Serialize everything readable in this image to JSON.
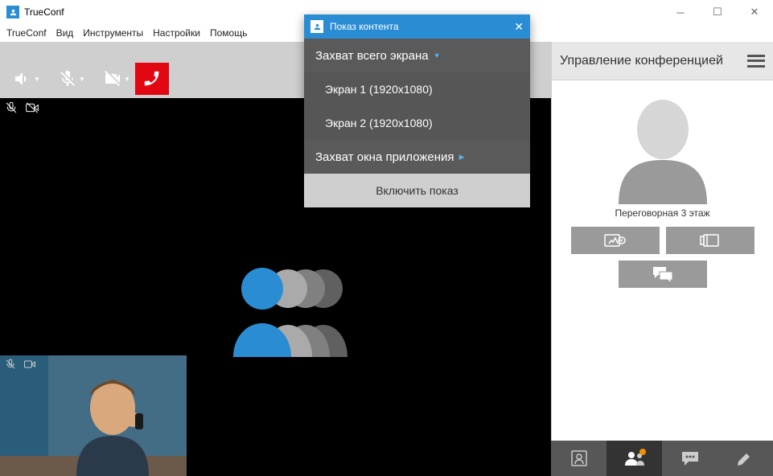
{
  "window": {
    "title": "TrueConf"
  },
  "menu": {
    "trueconf": "TrueConf",
    "view": "Вид",
    "tools": "Инструменты",
    "settings": "Настройки",
    "help": "Помощь"
  },
  "panel": {
    "title": "Управление конференцией",
    "participant": "Переговорная 3 этаж"
  },
  "popup": {
    "title": "Показ контента",
    "capture_screen": "Захват всего экрана",
    "screen1": "Экран 1 (1920x1080)",
    "screen2": "Экран 2 (1920x1080)",
    "capture_window": "Захват окна приложения",
    "start": "Включить показ"
  }
}
